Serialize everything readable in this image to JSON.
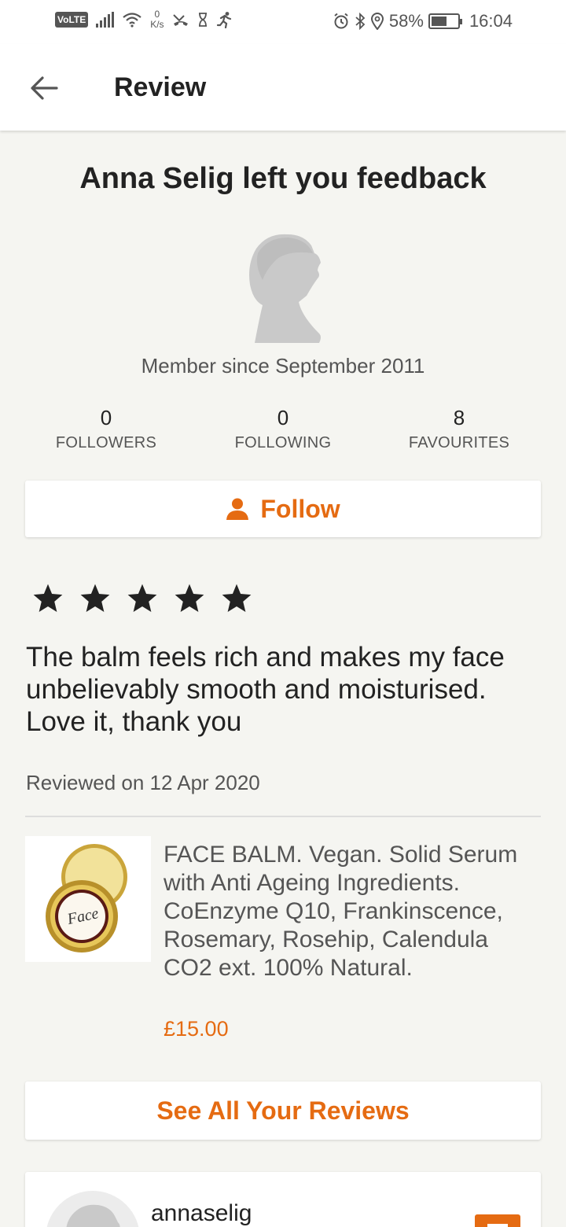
{
  "status_bar": {
    "volte": "VoLTE",
    "speed_value": "0",
    "speed_unit": "K/s",
    "battery": "58%",
    "battery_level": 0.58,
    "time": "16:04"
  },
  "app_bar": {
    "title": "Review",
    "back_icon": "arrow-left-icon"
  },
  "feedback": {
    "headline": "Anna Selig left you feedback",
    "member_since": "Member since September 2011"
  },
  "stats": [
    {
      "value": "0",
      "label": "FOLLOWERS"
    },
    {
      "value": "0",
      "label": "FOLLOWING"
    },
    {
      "value": "8",
      "label": "FAVOURITES"
    }
  ],
  "follow_button": {
    "label": "Follow",
    "icon": "person-icon"
  },
  "review": {
    "rating": 5,
    "text": "The balm feels rich and makes my face unbelievably smooth and moisturised. Love it, thank you",
    "date": "Reviewed on 12 Apr 2020"
  },
  "product": {
    "title": "FACE BALM. Vegan. Solid Serum with Anti Ageing Ingredients. CoEnzyme Q10, Frankinscence, Rosemary, Rosehip, Calendula CO2 ext. 100% Natural.",
    "price": "£15.00",
    "image_label": "Face"
  },
  "see_all_button": {
    "label": "See All Your Reviews"
  },
  "bottom_card": {
    "username": "annaselig"
  },
  "colors": {
    "accent": "#e56b12",
    "background": "#f5f5f1",
    "text": "#222222",
    "muted": "#555555"
  }
}
